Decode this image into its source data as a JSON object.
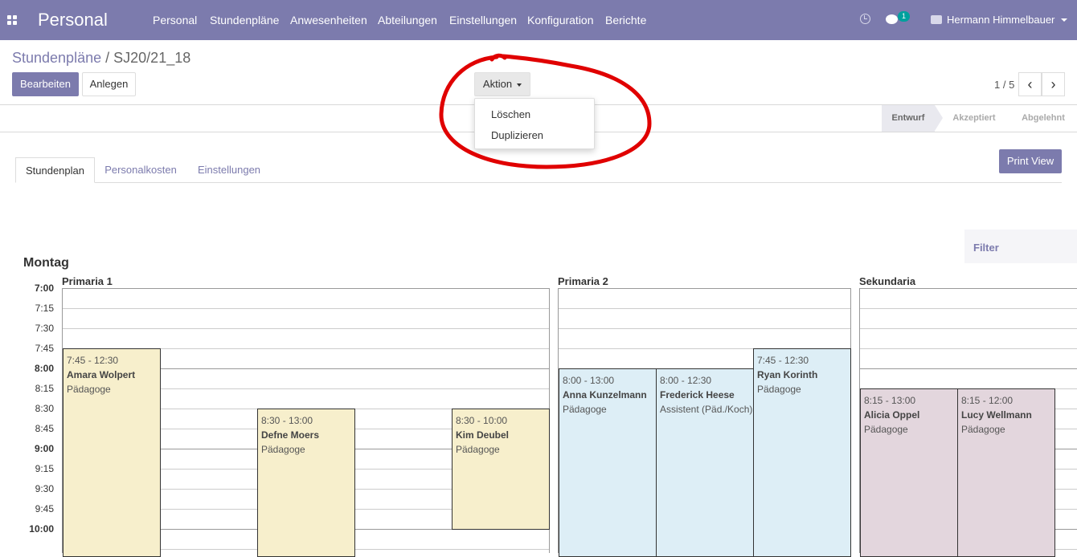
{
  "topbar": {
    "app_title": "Personal",
    "menu": [
      "Personal",
      "Stundenpläne",
      "Anwesenheiten",
      "Abteilungen",
      "Einstellungen",
      "Konfiguration",
      "Berichte"
    ],
    "chat_badge": "1",
    "user_name": "Hermann Himmelbauer"
  },
  "breadcrumb": {
    "parent": "Stundenpläne",
    "separator": "/",
    "current": "SJ20/21_18"
  },
  "buttons": {
    "edit": "Bearbeiten",
    "create": "Anlegen",
    "action": "Aktion",
    "print_view": "Print View"
  },
  "action_menu": [
    "Löschen",
    "Duplizieren"
  ],
  "pager": {
    "value": "1 / 5",
    "prev": "‹",
    "next": "›"
  },
  "statusbar": [
    "Entwurf",
    "Akzeptiert",
    "Abgelehnt"
  ],
  "tabs": [
    "Stundenplan",
    "Personalkosten",
    "Einstellungen"
  ],
  "filter": {
    "label": "Filter"
  },
  "schedule": {
    "day": "Montag",
    "times": [
      "7:00",
      "7:15",
      "7:30",
      "7:45",
      "8:00",
      "8:15",
      "8:30",
      "8:45",
      "9:00",
      "9:15",
      "9:30",
      "9:45",
      "10:00"
    ],
    "columns": [
      {
        "title": "Primaria 1",
        "events": [
          {
            "time": "7:45  -  12:30",
            "name": "Amara Wolpert",
            "role": "Pädagoge"
          },
          {
            "time": "8:30  -  13:00",
            "name": "Defne Moers",
            "role": "Pädagoge"
          },
          {
            "time": "8:30  -  10:00",
            "name": "Kim Deubel",
            "role": "Pädagoge"
          }
        ]
      },
      {
        "title": "Primaria 2",
        "events": [
          {
            "time": "8:00  -  13:00",
            "name": "Anna Kunzelmann",
            "role": "Pädagoge"
          },
          {
            "time": "8:00  -  12:30",
            "name": "Frederick Heese",
            "role": "Assistent (Päd./Koch)"
          },
          {
            "time": "7:45  -  12:30",
            "name": "Ryan Korinth",
            "role": "Pädagoge"
          }
        ]
      },
      {
        "title": "Sekundaria",
        "events": [
          {
            "time": "8:15  -  13:00",
            "name": "Alicia Oppel",
            "role": "Pädagoge"
          },
          {
            "time": "8:15  -  12:00",
            "name": "Lucy Wellmann",
            "role": "Pädagoge"
          }
        ]
      }
    ]
  },
  "colors": {
    "brand": "#7c7bad",
    "event_yellow": "#f7efcc",
    "event_blue": "#ddeef6",
    "event_purple": "#e3d6dd",
    "annotation_red": "#e00000"
  }
}
